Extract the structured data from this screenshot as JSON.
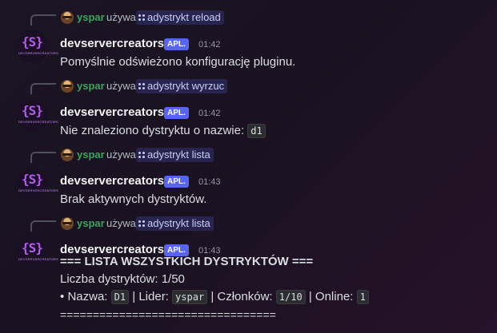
{
  "messages": [
    {
      "reply_user": "yspar",
      "reply_verb": "używa",
      "command": "adystrykt reload",
      "author": "devservercreators",
      "app_tag": "APL.",
      "time": "01:42",
      "text": "Pomyślnie odświeżono konfigurację pluginu."
    },
    {
      "reply_user": "yspar",
      "reply_verb": "używa",
      "command": "adystrykt wyrzuc",
      "author": "devservercreators",
      "app_tag": "APL.",
      "time": "01:42",
      "text": "Nie znaleziono dystryktu o nazwie:",
      "code": "d1"
    },
    {
      "reply_user": "yspar",
      "reply_verb": "używa",
      "command": "adystrykt lista",
      "author": "devservercreators",
      "app_tag": "APL.",
      "time": "01:43",
      "text": "Brak aktywnych dystryktów."
    },
    {
      "reply_user": "yspar",
      "reply_verb": "używa",
      "command": "adystrykt lista",
      "author": "devservercreators",
      "app_tag": "APL.",
      "time": "01:43",
      "header": "=== LISTA WSZYSTKICH DYSTRYKTÓW ===",
      "count_line": "Liczba dystryktów: 1/50",
      "entry": {
        "bullet": "•",
        "name_label": "Nazwa:",
        "name_value": "D1",
        "leader_label": "| Lider:",
        "leader_value": "yspar",
        "members_label": "| Członków:",
        "members_value": "1/10",
        "online_label": "| Online:",
        "online_value": "1"
      },
      "footer": "================================="
    }
  ],
  "avatar": {
    "brace_text": "{S}",
    "caption": "DEVSERVERCREATORS"
  },
  "colors": {
    "reply_user": "#3ba55d",
    "app_tag_bg": "#5865f2",
    "avatar_accent": "#b65cf0"
  }
}
